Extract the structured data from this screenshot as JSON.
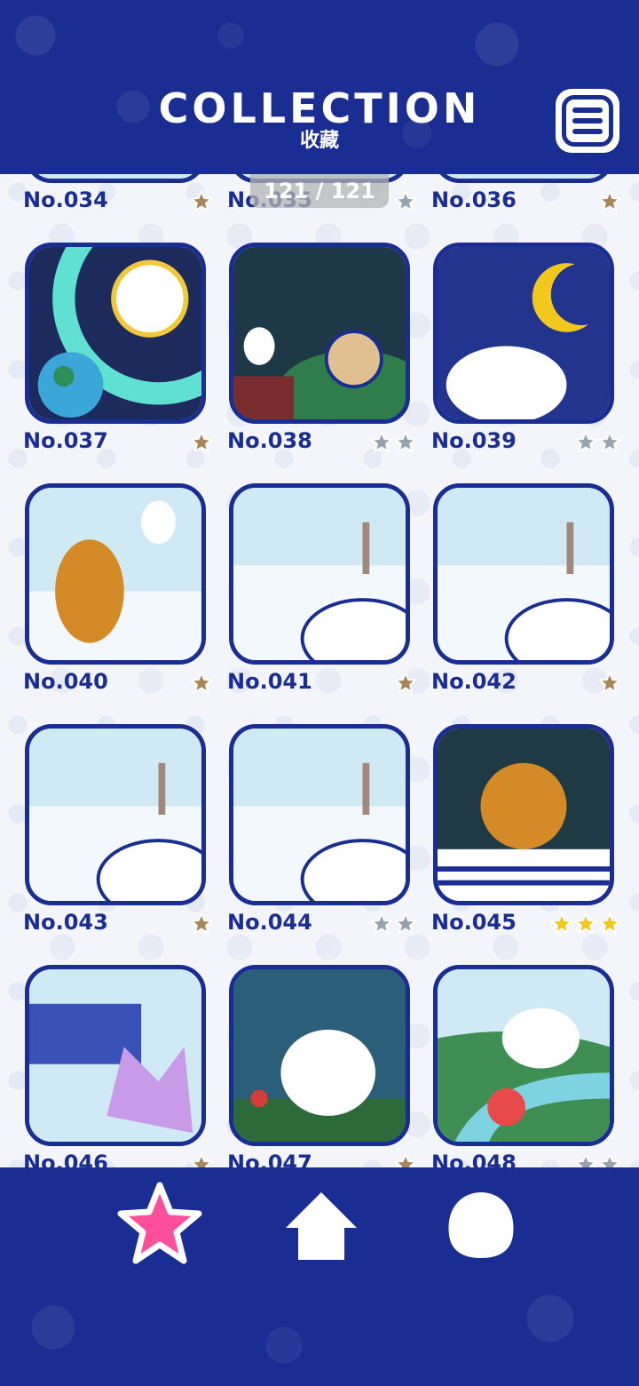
{
  "header": {
    "title": "COLLECTION",
    "subtitle": "收藏"
  },
  "pager": {
    "text": "121 / 121"
  },
  "colors": {
    "brand_blue": "#1a2d92",
    "star_bronze": "#a8865a",
    "star_silver": "#9aa3ad",
    "star_gold": "#f2c81e",
    "nav_pink": "#ff4f9a"
  },
  "cards": [
    {
      "label": "No.034",
      "stars": 1,
      "tier": "bronze",
      "scene": "none"
    },
    {
      "label": "No.035",
      "stars": 1,
      "tier": "silver",
      "scene": "none"
    },
    {
      "label": "No.036",
      "stars": 1,
      "tier": "bronze",
      "scene": "none"
    },
    {
      "label": "No.037",
      "stars": 1,
      "tier": "bronze",
      "scene": "space"
    },
    {
      "label": "No.038",
      "stars": 2,
      "tier": "silver",
      "scene": "bush-night"
    },
    {
      "label": "No.039",
      "stars": 2,
      "tier": "silver",
      "scene": "moon"
    },
    {
      "label": "No.040",
      "stars": 1,
      "tier": "bronze",
      "scene": "snow-bear"
    },
    {
      "label": "No.041",
      "stars": 1,
      "tier": "bronze",
      "scene": "snow"
    },
    {
      "label": "No.042",
      "stars": 1,
      "tier": "bronze",
      "scene": "snow"
    },
    {
      "label": "No.043",
      "stars": 1,
      "tier": "bronze",
      "scene": "snow"
    },
    {
      "label": "No.044",
      "stars": 2,
      "tier": "silver",
      "scene": "snow"
    },
    {
      "label": "No.045",
      "stars": 3,
      "tier": "gold",
      "scene": "car-night"
    },
    {
      "label": "No.046",
      "stars": 1,
      "tier": "bronze",
      "scene": "bus-snow"
    },
    {
      "label": "No.047",
      "stars": 1,
      "tier": "bronze",
      "scene": "forest"
    },
    {
      "label": "No.048",
      "stars": 2,
      "tier": "silver",
      "scene": "river"
    }
  ],
  "nav": {
    "items": [
      {
        "name": "collection",
        "icon": "star-icon"
      },
      {
        "name": "home",
        "icon": "home-icon"
      },
      {
        "name": "character",
        "icon": "dog-head-icon"
      }
    ]
  }
}
